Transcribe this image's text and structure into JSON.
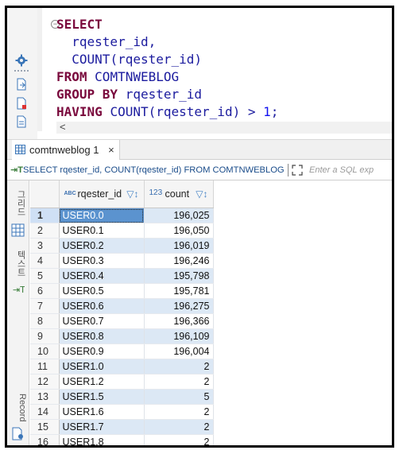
{
  "editor": {
    "lines": [
      [
        {
          "t": "SELECT",
          "c": "kw"
        }
      ],
      [
        {
          "t": "  rqester_id,",
          "c": "id"
        }
      ],
      [
        {
          "t": "  ",
          "c": "id"
        },
        {
          "t": "COUNT",
          "c": "fn"
        },
        {
          "t": "(rqester_id)",
          "c": "id"
        }
      ],
      [
        {
          "t": "FROM ",
          "c": "kw"
        },
        {
          "t": "COMTNWEBLOG",
          "c": "id"
        }
      ],
      [
        {
          "t": "GROUP BY ",
          "c": "kw"
        },
        {
          "t": "rqester_id",
          "c": "id"
        }
      ],
      [
        {
          "t": "HAVING ",
          "c": "kw"
        },
        {
          "t": "COUNT",
          "c": "fn"
        },
        {
          "t": "(rqester_id) > ",
          "c": "id"
        },
        {
          "t": "1",
          "c": "num"
        },
        {
          "t": ";",
          "c": "id"
        }
      ]
    ],
    "scroll_arrow": "<"
  },
  "result_tab": {
    "label": "comtnweblog 1",
    "close": "×"
  },
  "filter": {
    "query_text": "SELECT rqester_id, COUNT(rqester_id) FROM COMTNWEBLOG",
    "placeholder": "Enter a SQL exp"
  },
  "side_tabs": {
    "grid_label": "그리드",
    "text_label": "텍스트",
    "record_label": "Record"
  },
  "table": {
    "columns": [
      {
        "type": "ABC",
        "name": "rqester_id"
      },
      {
        "type": "123",
        "name": "count"
      }
    ],
    "rows": [
      {
        "n": "1",
        "id": "USER0.0",
        "count": "196,025"
      },
      {
        "n": "2",
        "id": "USER0.1",
        "count": "196,050"
      },
      {
        "n": "3",
        "id": "USER0.2",
        "count": "196,019"
      },
      {
        "n": "4",
        "id": "USER0.3",
        "count": "196,246"
      },
      {
        "n": "5",
        "id": "USER0.4",
        "count": "195,798"
      },
      {
        "n": "6",
        "id": "USER0.5",
        "count": "195,781"
      },
      {
        "n": "7",
        "id": "USER0.6",
        "count": "196,275"
      },
      {
        "n": "8",
        "id": "USER0.7",
        "count": "196,366"
      },
      {
        "n": "9",
        "id": "USER0.8",
        "count": "196,109"
      },
      {
        "n": "10",
        "id": "USER0.9",
        "count": "196,004"
      },
      {
        "n": "11",
        "id": "USER1.0",
        "count": "2"
      },
      {
        "n": "12",
        "id": "USER1.2",
        "count": "2"
      },
      {
        "n": "13",
        "id": "USER1.5",
        "count": "5"
      },
      {
        "n": "14",
        "id": "USER1.6",
        "count": "2"
      },
      {
        "n": "15",
        "id": "USER1.7",
        "count": "2"
      },
      {
        "n": "16",
        "id": "USER1.8",
        "count": "2"
      }
    ],
    "selected_row": 0
  },
  "colors": {
    "keyword": "#7a0a3d",
    "identifier": "#1b1b9e",
    "selection": "#5b93cf",
    "alt_row": "#dce8f5"
  }
}
